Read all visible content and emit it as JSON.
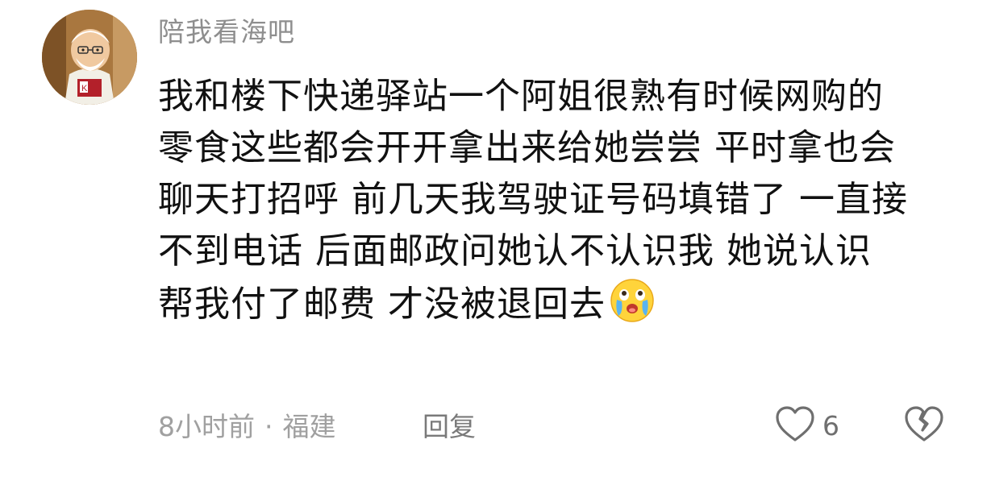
{
  "comment": {
    "username": "陪我看海吧",
    "avatar_icon": "avatar-figurine",
    "text_lines": [
      "我和楼下快递驿站一个阿姐很熟有时候网购的",
      "零食这些都会开开拿出来给她尝尝 平时拿也会",
      "聊天打招呼 前几天我驾驶证号码填错了 一直接",
      "不到电话 后面邮政问她认不认识我 她说认识",
      "帮我付了邮费 才没被退回去"
    ],
    "emoji_icon": "crying-laughing-face-icon",
    "time": "8小时前",
    "separator": "·",
    "location": "福建",
    "reply_label": "回复",
    "like_count": "6",
    "like_icon": "heart-outline-icon",
    "dislike_icon": "broken-heart-icon"
  },
  "colors": {
    "text": "#111111",
    "username": "#8e8e8e",
    "meta": "#a0a0a0",
    "icon": "#6f6f6f"
  }
}
